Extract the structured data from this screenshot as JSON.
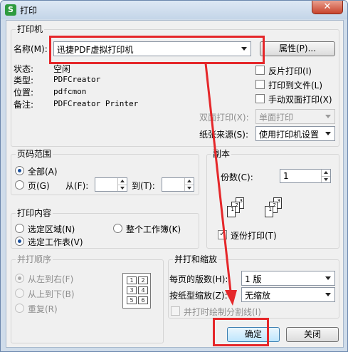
{
  "window": {
    "title": "打印",
    "app_icon": "S",
    "close_glyph": "✕"
  },
  "printer": {
    "group_title": "打印机",
    "name_label": "名称(M):",
    "name_value": "迅捷PDF虚拟打印机",
    "properties_button": "属性(P)...",
    "status_label": "状态:",
    "status_value": "空闲",
    "type_label": "类型:",
    "type_value": "PDFCreator",
    "location_label": "位置:",
    "location_value": "pdfcmon",
    "comment_label": "备注:",
    "comment_value": "PDFCreator Printer",
    "reverse_print": "反片打印(I)",
    "print_to_file": "打印到文件(L)",
    "manual_duplex": "手动双面打印(X)",
    "duplex_label": "双面打印(X):",
    "duplex_value": "单面打印",
    "paper_source_label": "纸张来源(S):",
    "paper_source_value": "使用打印机设置"
  },
  "page_range": {
    "group_title": "页码范围",
    "all": "全部(A)",
    "pages": "页(G)",
    "from_label": "从(F):",
    "to_label": "到(T):"
  },
  "print_content": {
    "group_title": "打印内容",
    "selection": "选定区域(N)",
    "workbook": "整个工作簿(K)",
    "worksheet": "选定工作表(V)"
  },
  "copies": {
    "group_title": "副本",
    "count_label": "份数(C):",
    "count_value": "1",
    "collate": "逐份打印(T)",
    "page_icons": [
      "1",
      "2",
      "3",
      "1",
      "2",
      "3"
    ]
  },
  "print_order": {
    "group_title": "并打顺序",
    "left_to_right": "从左到右(F)",
    "top_to_bottom": "从上到下(B)",
    "repeat": "重复(R)",
    "cells": [
      "1",
      "2",
      "3",
      "4",
      "5",
      "6"
    ]
  },
  "zoom": {
    "group_title": "并打和缩放",
    "pages_per_sheet_label": "每页的版数(H):",
    "pages_per_sheet_value": "1 版",
    "scale_label": "按纸型缩放(Z):",
    "scale_value": "无缩放",
    "draw_borders": "并打时绘制分割线(I)"
  },
  "buttons": {
    "ok": "确定",
    "close": "关闭"
  },
  "colors": {
    "annotation_red": "#e5272a"
  }
}
